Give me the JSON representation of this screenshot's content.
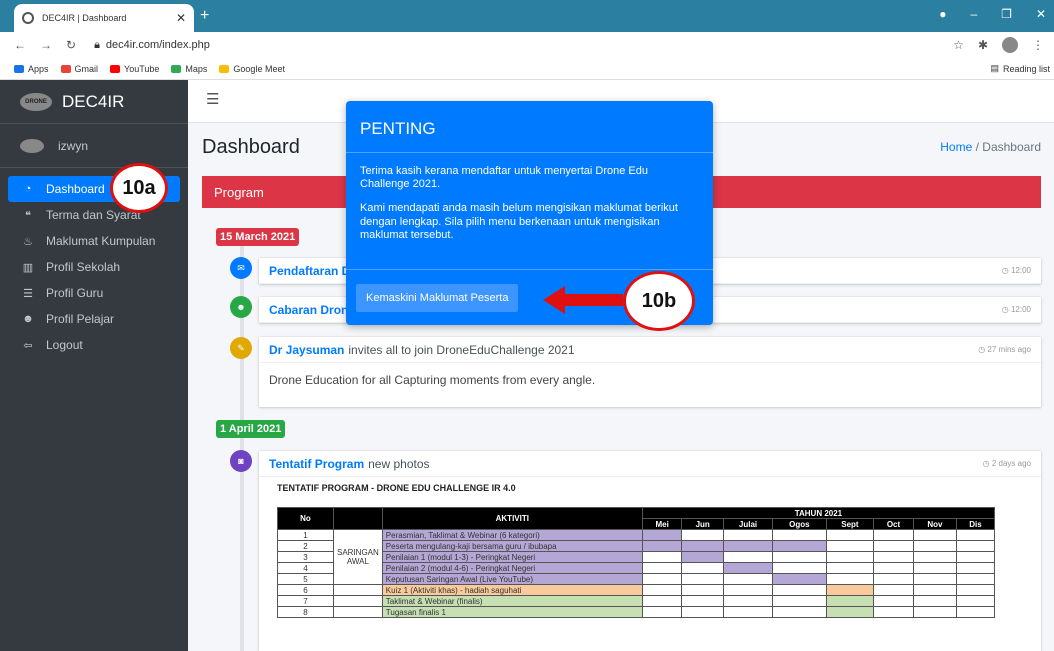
{
  "browser": {
    "tab_title": "DEC4IR | Dashboard",
    "url": "dec4ir.com/index.php",
    "bookmarks": [
      "Apps",
      "Gmail",
      "YouTube",
      "Maps",
      "Google Meet"
    ],
    "reading_list": "Reading list"
  },
  "sidebar": {
    "brand": "DEC4IR",
    "user": "izwyn",
    "logo_text": "DRONE",
    "items": [
      {
        "label": "Dashboard",
        "icon": "dashboard-icon"
      },
      {
        "label": "Terma dan Syarat",
        "icon": "quote-icon"
      },
      {
        "label": "Maklumat Kumpulan",
        "icon": "fire-icon"
      },
      {
        "label": "Profil Sekolah",
        "icon": "building-icon"
      },
      {
        "label": "Profil Guru",
        "icon": "list-icon"
      },
      {
        "label": "Profil Pelajar",
        "icon": "user-icon"
      },
      {
        "label": "Logout",
        "icon": "logout-icon"
      }
    ]
  },
  "page": {
    "title": "Dashboard",
    "breadcrumb_home": "Home",
    "breadcrumb_current": "Dashboard",
    "card_title": "Program"
  },
  "timeline": {
    "date1": "15 March 2021",
    "date2": "1 April 2021",
    "item1_title": "Pendaftaran D",
    "item1_time": "12:00",
    "item2_title": "Cabaran Dron",
    "item2_time": "12:00",
    "item3_author": "Dr Jaysuman",
    "item3_text": "invites all to join DroneEduChallenge 2021",
    "item3_time": "27 mins ago",
    "item3_body": "Drone Education for all Capturing moments from every angle.",
    "item4_title": "Tentatif Program",
    "item4_text": "new photos",
    "item4_time": "2 days ago"
  },
  "schedule": {
    "title": "TENTATIF PROGRAM - DRONE EDU CHALLENGE IR 4.0",
    "col_no": "No",
    "col_activity": "AKTIVITI",
    "col_year": "TAHUN 2021",
    "months": [
      "Mei",
      "Jun",
      "Julai",
      "Ogos",
      "Sept",
      "Oct",
      "Nov",
      "Dis"
    ],
    "group_label": "SARINGAN AWAL",
    "rows": [
      {
        "no": "1",
        "activity": "Perasmian, Taklimat & Webinar (6 kategori)"
      },
      {
        "no": "2",
        "activity": "Peserta mengulang-kaji bersama guru / ibubapa"
      },
      {
        "no": "3",
        "activity": "Penilaian 1 (modul 1-3) - Peringkat Negeri"
      },
      {
        "no": "4",
        "activity": "Penilaian 2 (modul 4-6) - Peringkat Negeri"
      },
      {
        "no": "5",
        "activity": "Keputusan Saringan Awal (Live YouTube)"
      },
      {
        "no": "6",
        "activity": "Kuiz 1 (Aktiviti khas) - hadiah saguhati"
      },
      {
        "no": "7",
        "activity": "Taklimat & Webinar (finalis)"
      },
      {
        "no": "8",
        "activity": "Tugasan finalis 1"
      }
    ]
  },
  "modal": {
    "title": "PENTING",
    "para1": "Terima kasih kerana mendaftar untuk menyertai Drone Edu Challenge 2021.",
    "para2": "Kami mendapati anda masih belum mengisikan maklumat berikut dengan lengkap. Sila pilih menu berkenaan untuk mengisikan maklumat tersebut.",
    "button": "Kemaskini Maklumat Peserta"
  },
  "annotations": {
    "a": "10a",
    "b": "10b"
  },
  "colors": {
    "primary": "#007bff",
    "danger": "#dc3545",
    "sidebar": "#343a40",
    "success": "#28a745"
  }
}
